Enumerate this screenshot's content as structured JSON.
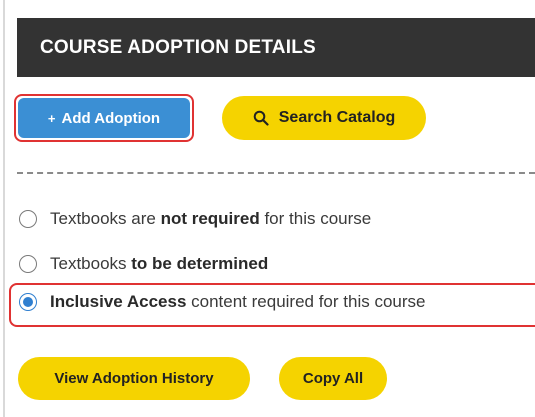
{
  "header": {
    "title": "COURSE ADOPTION DETAILS"
  },
  "actions": {
    "add_adoption_label": "Add Adoption",
    "add_adoption_prefix": "+",
    "search_catalog_label": "Search Catalog",
    "search_icon": "magnifier-icon"
  },
  "options": [
    {
      "prefix": "Textbooks are ",
      "bold": "not required",
      "suffix": " for this course",
      "selected": false
    },
    {
      "prefix": "Textbooks ",
      "bold": "to be determined",
      "suffix": "",
      "selected": false
    },
    {
      "prefix": "",
      "bold": "Inclusive Access",
      "suffix": " content required for this course",
      "selected": true
    }
  ],
  "footer": {
    "view_history_label": "View Adoption History",
    "copy_all_label": "Copy All"
  },
  "colors": {
    "header_bg": "#333333",
    "primary_blue": "#3b8fd4",
    "accent_yellow": "#f5d300",
    "highlight_red": "#e03232"
  }
}
